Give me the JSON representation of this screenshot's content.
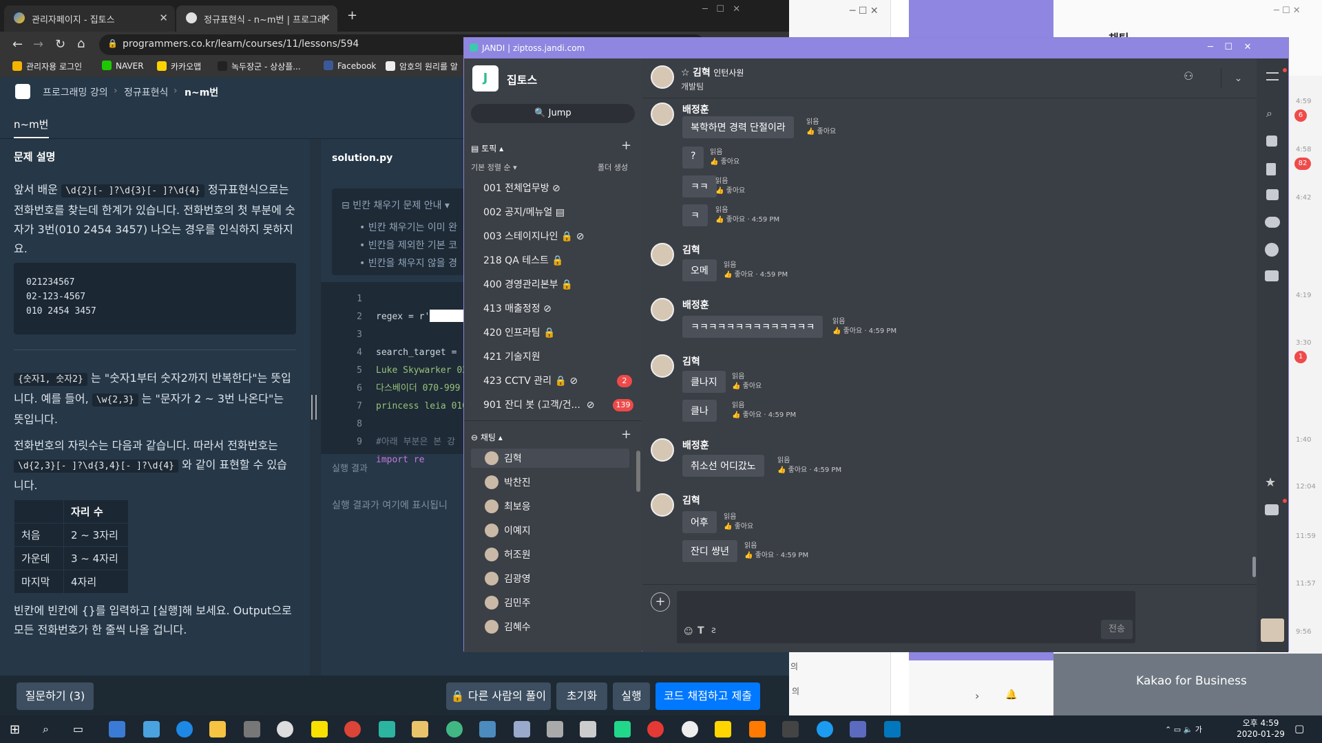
{
  "chrome": {
    "tab1_title": "관리자페이지 - 집토스",
    "tab2_title": "정규표현식 - n~m번 | 프로그래",
    "new_tab": "+",
    "address": "programmers.co.kr/learn/courses/11/lessons/594",
    "bookmarks": [
      "관리자용 로그인",
      "NAVER",
      "카카오맵",
      "녹두장군 - 상상플...",
      "Facebook",
      "암호의 원리를 알"
    ]
  },
  "programmers": {
    "breadcrumb": [
      "프로그래밍 강의",
      "정규표현식",
      "n~m번"
    ],
    "tab_title": "n~m번",
    "section_title": "문제 설명",
    "para1_pre": "앞서 배운",
    "para1_code": "\\d{2}[- ]?\\d{3}[- ]?\\d{4}",
    "para1_post": "정규표현식으로는 전화번호를 찾는데 한계가 있습니다. 전화번호의 첫 부분에 숫자가 3번(010 2454 3457) 나오는 경우를 인식하지 못하지요.",
    "code_block": [
      "021234567",
      "02-123-4567",
      "010 2454 3457"
    ],
    "para2_code1": "{숫자1, 숫자2}",
    "para2_a": "는 \"숫자1부터 숫자2까지 반복한다\"는 뜻입니다. 예를 들어,",
    "para2_code2": "\\w{2,3}",
    "para2_b": "는 \"문자가 2 ~ 3번 나온다\"는 뜻입니다.",
    "para3_a": "전화번호의 자릿수는 다음과 같습니다. 따라서 전화번호는",
    "para3_code": "\\d{2,3}[- ]?\\d{3,4}[- ]?\\d{4}",
    "para3_b": "와 같이 표현할 수 있습니다.",
    "table_header": "자리 수",
    "table_rows": [
      [
        "처음",
        "2 ~ 3자리"
      ],
      [
        "가운데",
        "3 ~ 4자리"
      ],
      [
        "마지막",
        "4자리"
      ]
    ],
    "para4": "빈칸에 빈칸에 {}를 입력하고 [실행]해 보세요. Output으로 모든 전화번호가 한 줄씩 나올 겁니다.",
    "file_name": "solution.py",
    "hint_title": "빈칸 채우기 문제 안내",
    "hints": [
      "빈칸 채우기는 이미 완",
      "빈칸을 제외한 기본 코",
      "빈칸을 채우지 않을 경"
    ],
    "code_lines": [
      "regex = r'",
      "",
      "search_target = '",
      "Luke Skywarker 02",
      "다스베이더 070-999",
      "princess leia 010",
      "",
      "#아래 부분은 본 강",
      "import re"
    ],
    "result_label": "실행 결과",
    "result_placeholder": "실행 결과가 여기에 표시됩니",
    "btn_question": "질문하기 (3)",
    "btn_others": "다른 사람의 풀이",
    "btn_reset": "초기화",
    "btn_run": "실행",
    "btn_submit": "코드 채점하고 제출"
  },
  "jandi": {
    "title": "JANDI | ziptoss.jandi.com",
    "team": "집토스",
    "jump": "Jump",
    "topics_label": "토픽",
    "sort_label": "기본 정렬 순",
    "folder_label": "폴더 생성",
    "topics": [
      "001 전체업무방",
      "002 공지/메뉴얼",
      "003 스테이지나인",
      "218 QA 테스트",
      "400 경영관리본부",
      "413 매출정정",
      "420 인프라팀",
      "421 기술지원",
      "423 CCTV 관리",
      "901 잔디 봇 (고객/건..."
    ],
    "topic_badges": {
      "423": "2",
      "901": "139"
    },
    "chat_label": "채팅",
    "dms": [
      "김혁",
      "박찬진",
      "최보응",
      "이예지",
      "허조원",
      "김광영",
      "김민주",
      "김혜수"
    ],
    "header_name": "김혁",
    "header_role": "인턴사원",
    "header_team": "개발팀",
    "read": "읽음",
    "like": "좋아요",
    "messages": [
      {
        "name": "배정훈",
        "lines": [
          "복학하면 경력 단절이라",
          "?",
          "ㅋㅋ",
          "ㅋ"
        ],
        "time": "4:59 PM"
      },
      {
        "name": "김혁",
        "lines": [
          "오메"
        ],
        "time": "4:59 PM"
      },
      {
        "name": "배정훈",
        "lines": [
          "ㅋㅋㅋㅋㅋㅋㅋㅋㅋㅋㅋㅋㅋㅋ"
        ],
        "time": "4:59 PM"
      },
      {
        "name": "김혁",
        "lines": [
          "클나지",
          "클나"
        ],
        "time": "4:59 PM"
      },
      {
        "name": "배정훈",
        "lines": [
          "취소선 어디갔노"
        ],
        "time": "4:59 PM"
      },
      {
        "name": "김혁",
        "lines": [
          "어후",
          "잔디 썅년"
        ],
        "time": "4:59 PM"
      }
    ],
    "send": "전송"
  },
  "right": {
    "title": "채팅",
    "timeline": [
      "4:59",
      "4:58",
      "4:42",
      "4:19",
      "3:30",
      "1:40",
      "12:04",
      "11:59",
      "11:57",
      "9:56"
    ],
    "badges": [
      "6",
      "82",
      "1"
    ],
    "kakao": "Kakao for Business"
  },
  "taskbar": {
    "time": "오후 4:59",
    "date": "2020-01-29",
    "ime": "가"
  }
}
